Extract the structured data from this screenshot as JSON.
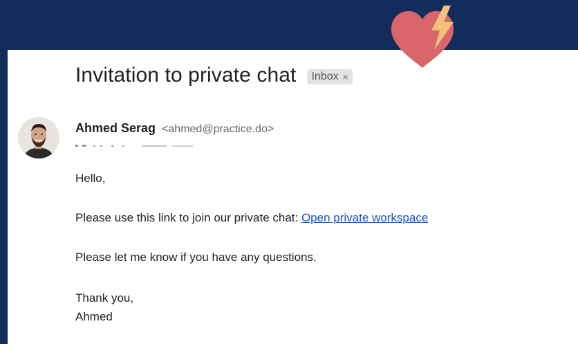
{
  "email": {
    "subject": "Invitation to private chat",
    "label": "Inbox",
    "label_close": "×",
    "sender_name": "Ahmed Serag",
    "sender_email": "<ahmed@practice.do>",
    "body": {
      "greeting": "Hello,",
      "line1_text": "Please use this link to join our private chat: ",
      "link_text": "Open private workspace",
      "line2": "Please let me know if you have any questions.",
      "closing": "Thank you,",
      "signature": "Ahmed"
    }
  },
  "colors": {
    "background": "#122c5c",
    "link": "#1a55c9",
    "heart": "#d9666a",
    "bolt": "#f0c27b"
  },
  "icons": {
    "decoration": "heart-with-lightning-icon"
  }
}
